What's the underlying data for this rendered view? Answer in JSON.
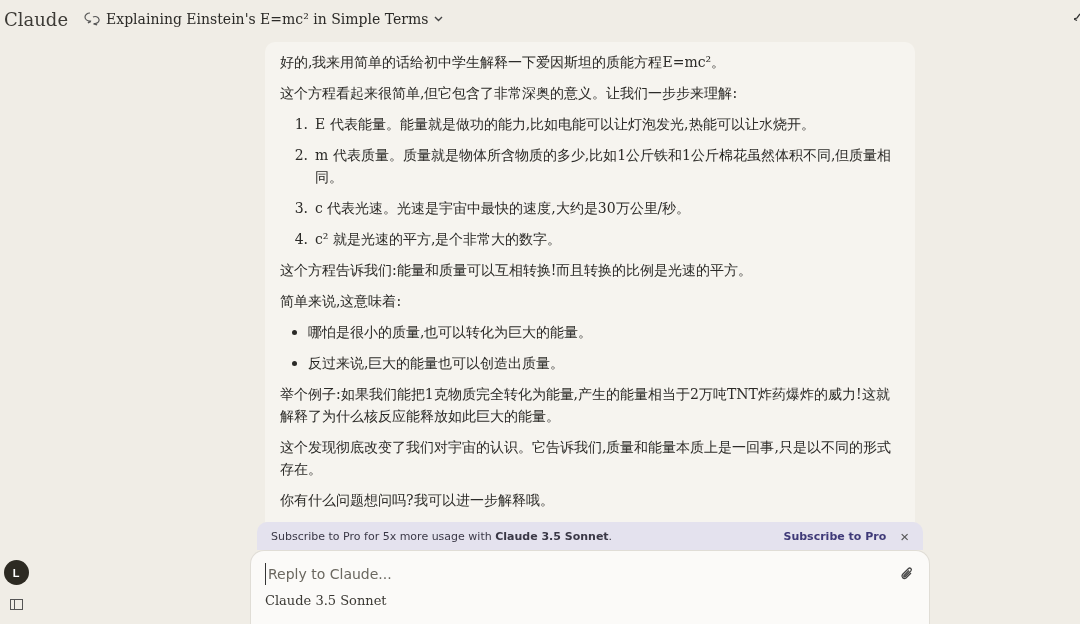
{
  "header": {
    "brand": "Claude",
    "title": "Explaining Einstein's E=mc² in Simple Terms"
  },
  "message": {
    "blocks": [
      {
        "kind": "paragraph",
        "text": "好的,我来用简单的话给初中学生解释一下爱因斯坦的质能方程E=mc²。"
      },
      {
        "kind": "paragraph",
        "text": "这个方程看起来很简单,但它包含了非常深奥的意义。让我们一步步来理解:"
      },
      {
        "kind": "ordered",
        "items": [
          {
            "marker": "1.",
            "text": "E 代表能量。能量就是做功的能力,比如电能可以让灯泡发光,热能可以让水烧开。"
          },
          {
            "marker": "2.",
            "text": "m 代表质量。质量就是物体所含物质的多少,比如1公斤铁和1公斤棉花虽然体积不同,但质量相同。"
          },
          {
            "marker": "3.",
            "text": "c 代表光速。光速是宇宙中最快的速度,大约是30万公里/秒。"
          },
          {
            "marker": "4.",
            "text": "c² 就是光速的平方,是个非常大的数字。"
          }
        ]
      },
      {
        "kind": "paragraph",
        "text": "这个方程告诉我们:能量和质量可以互相转换!而且转换的比例是光速的平方。"
      },
      {
        "kind": "paragraph",
        "text": "简单来说,这意味着:"
      },
      {
        "kind": "bullets",
        "items": [
          {
            "text": "哪怕是很小的质量,也可以转化为巨大的能量。"
          },
          {
            "text": "反过来说,巨大的能量也可以创造出质量。"
          }
        ]
      },
      {
        "kind": "paragraph",
        "text": "举个例子:如果我们能把1克物质完全转化为能量,产生的能量相当于2万吨TNT炸药爆炸的威力!这就解释了为什么核反应能释放如此巨大的能量。"
      },
      {
        "kind": "paragraph",
        "text": "这个发现彻底改变了我们对宇宙的认识。它告诉我们,质量和能量本质上是一回事,只是以不同的形式存在。"
      },
      {
        "kind": "paragraph",
        "text": "你有什么问题想问吗?我可以进一步解释哦。"
      }
    ]
  },
  "banner": {
    "text": "Subscribe to Pro for 5x more usage with **Claude 3.5 Sonnet**.",
    "action": "Subscribe to Pro",
    "close": "×"
  },
  "composer": {
    "placeholder": "Reply to Claude...",
    "model": "Claude 3.5 Sonnet"
  },
  "sidebar": {
    "avatar": "L"
  }
}
